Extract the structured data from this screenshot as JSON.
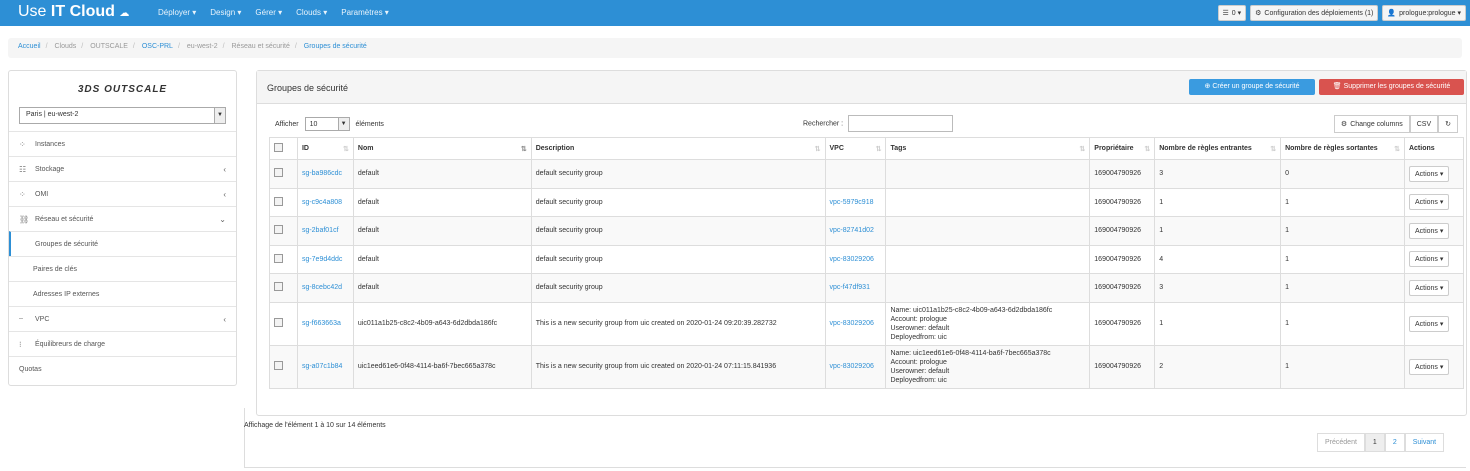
{
  "topbar": {
    "logo_use": "Use",
    "logo_it": "IT Cloud",
    "nav": [
      "Déployer ▾",
      "Design ▾",
      "Gérer ▾",
      "Clouds ▾",
      "Paramètres ▾"
    ],
    "notif": "0 ▾",
    "config": "Configuration des déploiements (1)",
    "user": "prologue:prologue ▾"
  },
  "breadcrumb": {
    "items": [
      "Accueil",
      "Clouds",
      "OUTSCALE",
      "OSC-PRL",
      "eu-west-2",
      "Réseau et sécurité",
      "Groupes de sécurité"
    ]
  },
  "sidebar": {
    "brand": "3DS OUTSCALE",
    "region": "Paris | eu-west-2",
    "items": [
      {
        "label": "Instances"
      },
      {
        "label": "Stockage"
      },
      {
        "label": "OMI"
      },
      {
        "label": "Réseau et sécurité"
      },
      {
        "label": "Groupes de sécurité"
      },
      {
        "label": "Paires de clés"
      },
      {
        "label": "Adresses IP externes"
      },
      {
        "label": "VPC"
      },
      {
        "label": "Équilibreurs de charge"
      },
      {
        "label": "Quotas"
      }
    ]
  },
  "panel": {
    "title": "Groupes de sécurité",
    "create_btn": "Créer un groupe de sécurité",
    "delete_btn": "Supprimer les groupes de sécurité",
    "show_label": "Afficher",
    "show_value": "10",
    "elements_label": "éléments",
    "search_label": "Rechercher :",
    "search_value": "",
    "change_columns": "Change columns",
    "csv": "CSV"
  },
  "table": {
    "headers": [
      "ID",
      "Nom",
      "Description",
      "VPC",
      "Tags",
      "Propriétaire",
      "Nombre de règles entrantes",
      "Nombre de règles sortantes",
      "Actions"
    ],
    "rows": [
      {
        "id": "sg-ba986cdc",
        "nom": "default",
        "desc": "default security group",
        "vpc": "",
        "tags": [],
        "owner": "169004790926",
        "in": "3",
        "out": "0",
        "action": "Actions ▾"
      },
      {
        "id": "sg-c9c4a808",
        "nom": "default",
        "desc": "default security group",
        "vpc": "vpc-5979c918",
        "tags": [],
        "owner": "169004790926",
        "in": "1",
        "out": "1",
        "action": "Actions ▾"
      },
      {
        "id": "sg-2baf01cf",
        "nom": "default",
        "desc": "default security group",
        "vpc": "vpc-82741d02",
        "tags": [],
        "owner": "169004790926",
        "in": "1",
        "out": "1",
        "action": "Actions ▾"
      },
      {
        "id": "sg-7e9d4ddc",
        "nom": "default",
        "desc": "default security group",
        "vpc": "vpc-83029206",
        "tags": [],
        "owner": "169004790926",
        "in": "4",
        "out": "1",
        "action": "Actions ▾"
      },
      {
        "id": "sg-8cebc42d",
        "nom": "default",
        "desc": "default security group",
        "vpc": "vpc-f47df931",
        "tags": [],
        "owner": "169004790926",
        "in": "3",
        "out": "1",
        "action": "Actions ▾"
      },
      {
        "id": "sg-f663663a",
        "nom": "uic011a1b25-c8c2-4b09-a643-6d2dbda186fc",
        "desc": "This is a new security group from uic created on 2020-01-24 09:20:39.282732",
        "vpc": "vpc-83029206",
        "tags": [
          "Name: uic011a1b25-c8c2-4b09-a643-6d2dbda186fc",
          "Account: prologue",
          "Userowner: default",
          "Deployedfrom: uic"
        ],
        "owner": "169004790926",
        "in": "1",
        "out": "1",
        "action": "Actions ▾"
      },
      {
        "id": "sg-a07c1b84",
        "nom": "uic1eed61e6-0f48-4114-ba6f-7bec665a378c",
        "desc": "This is a new security group from uic created on 2020-01-24 07:11:15.841936",
        "vpc": "vpc-83029206",
        "tags": [
          "Name: uic1eed61e6-0f48-4114-ba6f-7bec665a378c",
          "Account: prologue",
          "Userowner: default",
          "Deployedfrom: uic"
        ],
        "owner": "169004790926",
        "in": "2",
        "out": "1",
        "action": "Actions ▾"
      }
    ]
  },
  "footer": {
    "info": "Affichage de l'élément 1 à 10 sur 14 éléments",
    "prev": "Précédent",
    "pages": [
      "1",
      "2"
    ],
    "next": "Suivant"
  }
}
